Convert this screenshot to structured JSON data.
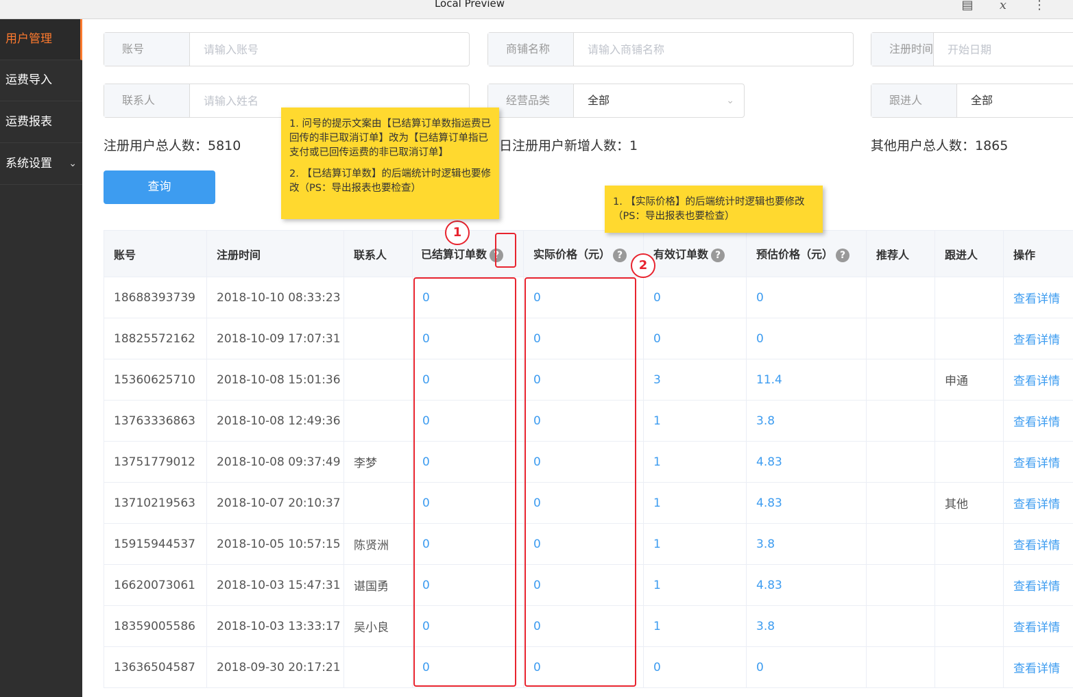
{
  "window": {
    "title": "Local Preview"
  },
  "sidebar": {
    "items": [
      {
        "label": "用户管理",
        "active": true
      },
      {
        "label": "运费导入"
      },
      {
        "label": "运费报表"
      },
      {
        "label": "系统设置",
        "chevron": "chevron-down-icon"
      }
    ]
  },
  "filters": {
    "account": {
      "label": "账号",
      "placeholder": "请输入账号"
    },
    "shop": {
      "label": "商铺名称",
      "placeholder": "请输入商铺名称"
    },
    "reg_time": {
      "label": "注册时间",
      "placeholder": "开始日期"
    },
    "contact": {
      "label": "联系人",
      "placeholder": "请输入姓名"
    },
    "category": {
      "label": "经营品类",
      "value": "全部"
    },
    "follower": {
      "label": "跟进人",
      "value": "全部"
    }
  },
  "stats": {
    "total": "注册用户总人数：5810",
    "today": "日注册用户新增人数：1",
    "other": "其他用户总人数：1865"
  },
  "query_button": "查询",
  "notes": {
    "note1": [
      "1. 问号的提示文案由【已结算订单数指运费已回传的非已取消订单】改为【已结算订单指已支付或已回传运费的非已取消订单】",
      "2. 【已结算订单数】的后端统计时逻辑也要修改（PS：导出报表也要检查）"
    ],
    "note2": [
      "1. 【实际价格】的后端统计时逻辑也要修改（PS：导出报表也要检查）"
    ]
  },
  "annotations": {
    "marker1": "1",
    "marker2": "2"
  },
  "table": {
    "headers": [
      "账号",
      "注册时间",
      "联系人",
      "已结算订单数",
      "实际价格（元）",
      "有效订单数",
      "预估价格（元）",
      "推荐人",
      "跟进人",
      "操作"
    ],
    "help_mark": "?",
    "rows": [
      [
        "18688393739",
        "2018-10-10 08:33:23",
        "",
        "0",
        "0",
        "0",
        "0",
        "",
        "",
        "查看详情"
      ],
      [
        "18825572162",
        "2018-10-09 17:07:31",
        "",
        "0",
        "0",
        "0",
        "0",
        "",
        "",
        "查看详情"
      ],
      [
        "15360625710",
        "2018-10-08 15:01:36",
        "",
        "0",
        "0",
        "3",
        "11.4",
        "",
        "申通",
        "查看详情"
      ],
      [
        "13763336863",
        "2018-10-08 12:49:36",
        "",
        "0",
        "0",
        "1",
        "3.8",
        "",
        "",
        "查看详情"
      ],
      [
        "13751779012",
        "2018-10-08 09:37:49",
        "李梦",
        "0",
        "0",
        "1",
        "4.83",
        "",
        "",
        "查看详情"
      ],
      [
        "13710219563",
        "2018-10-07 20:10:37",
        "",
        "0",
        "0",
        "1",
        "4.83",
        "",
        "其他",
        "查看详情"
      ],
      [
        "15915944537",
        "2018-10-05 10:57:15",
        "陈贤洲",
        "0",
        "0",
        "1",
        "3.8",
        "",
        "",
        "查看详情"
      ],
      [
        "16620073061",
        "2018-10-03 15:47:31",
        "谌国勇",
        "0",
        "0",
        "1",
        "4.83",
        "",
        "",
        "查看详情"
      ],
      [
        "18359005586",
        "2018-10-03 13:33:17",
        "吴小良",
        "0",
        "0",
        "1",
        "3.8",
        "",
        "",
        "查看详情"
      ],
      [
        "13636504587",
        "2018-09-30 20:17:21",
        "",
        "0",
        "0",
        "0",
        "0",
        "",
        "",
        "查看详情"
      ]
    ]
  }
}
